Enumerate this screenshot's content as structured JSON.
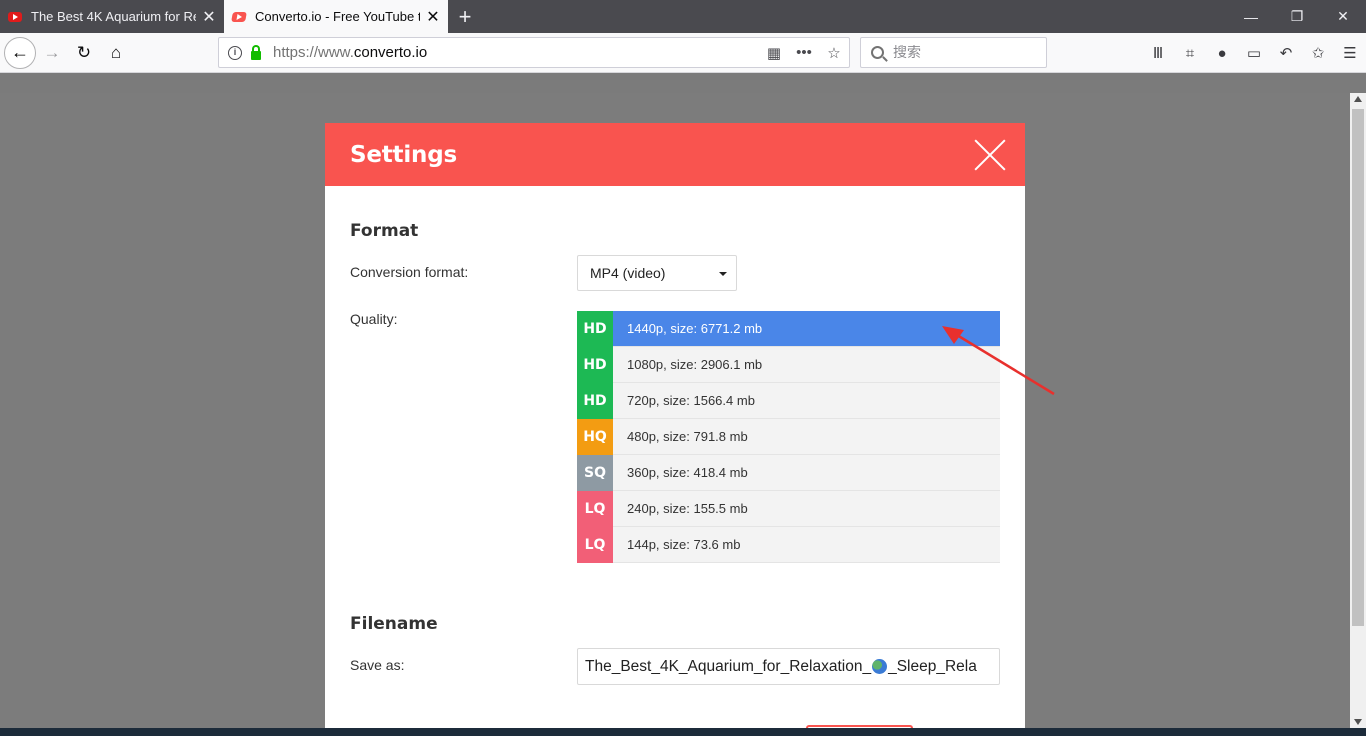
{
  "browser": {
    "tabs": [
      {
        "title": "The Best 4K Aquarium for Re",
        "active": false
      },
      {
        "title": "Converto.io - Free YouTube t",
        "active": true
      }
    ],
    "url_prefix": "https://www.",
    "url_domain": "converto.io",
    "search_placeholder": "搜索"
  },
  "modal": {
    "title": "Settings",
    "format_section": "Format",
    "conversion_label": "Conversion format:",
    "conversion_value": "MP4 (video)",
    "quality_label": "Quality:",
    "qualities": [
      {
        "badge": "HD",
        "text": "1440p, size: 6771.2 mb",
        "color": "#1db954",
        "selected": true
      },
      {
        "badge": "HD",
        "text": "1080p, size: 2906.1 mb",
        "color": "#1db954",
        "selected": false
      },
      {
        "badge": "HD",
        "text": "720p, size: 1566.4 mb",
        "color": "#1db954",
        "selected": false
      },
      {
        "badge": "HQ",
        "text": "480p, size: 791.8 mb",
        "color": "#f39c12",
        "selected": false
      },
      {
        "badge": "SQ",
        "text": "360p, size: 418.4 mb",
        "color": "#8e9aa3",
        "selected": false
      },
      {
        "badge": "LQ",
        "text": "240p, size: 155.5 mb",
        "color": "#f25f77",
        "selected": false
      },
      {
        "badge": "LQ",
        "text": "144p, size: 73.6 mb",
        "color": "#f25f77",
        "selected": false
      }
    ],
    "filename_section": "Filename",
    "save_as_label": "Save as:",
    "filename_start": "The_Best_4K_Aquarium_for_Relaxation_",
    "filename_end": "_Sleep_Rela"
  },
  "colors": {
    "accent": "#f9544f",
    "selected": "#4a86e8"
  }
}
